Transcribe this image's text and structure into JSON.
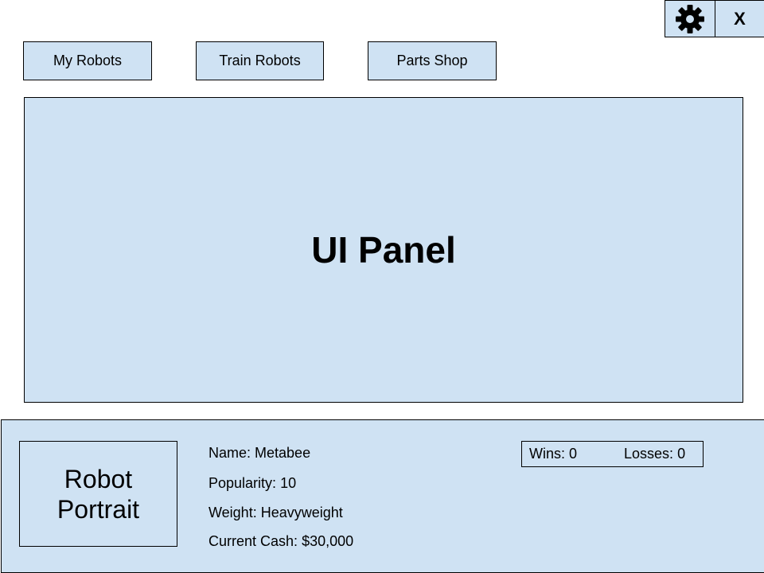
{
  "top_controls": {
    "settings_icon": "gear-icon",
    "close_label": "X"
  },
  "nav": {
    "my_robots": "My Robots",
    "train_robots": "Train Robots",
    "parts_shop": "Parts Shop"
  },
  "main_panel": {
    "title": "UI Panel"
  },
  "robot": {
    "portrait_line1": "Robot",
    "portrait_line2": "Portrait",
    "name_label": "Name:",
    "name": "Metabee",
    "popularity_label": "Popularity:",
    "popularity": "10",
    "weight_label": "Weight:",
    "weight": "Heavyweight",
    "cash_label": "Current Cash:",
    "cash": "$30,000"
  },
  "record": {
    "wins_label": "Wins:",
    "wins": "0",
    "losses_label": "Losses:",
    "losses": "0"
  },
  "colors": {
    "panel_fill": "#cfe2f3",
    "border": "#000000"
  }
}
